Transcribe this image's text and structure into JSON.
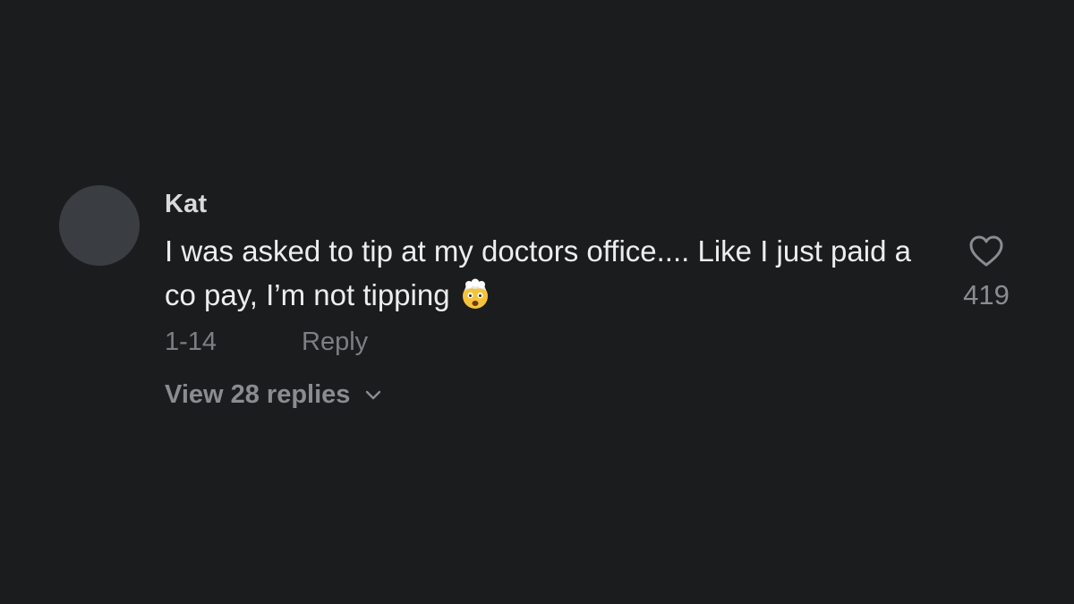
{
  "comment": {
    "username": "Kat",
    "text": "I was asked to tip at my doctors office.... Like I just paid a co pay, I’m not tipping",
    "emoji_icon": "exploding-head-icon",
    "date": "1-14",
    "reply_label": "Reply",
    "view_replies_label": "View 28 replies",
    "like_icon": "heart-outline-icon",
    "like_count": "419"
  },
  "colors": {
    "background": "#1b1c1e",
    "avatar": "#3a3d41",
    "text_primary": "#ededee",
    "text_secondary": "#7d7f83"
  }
}
